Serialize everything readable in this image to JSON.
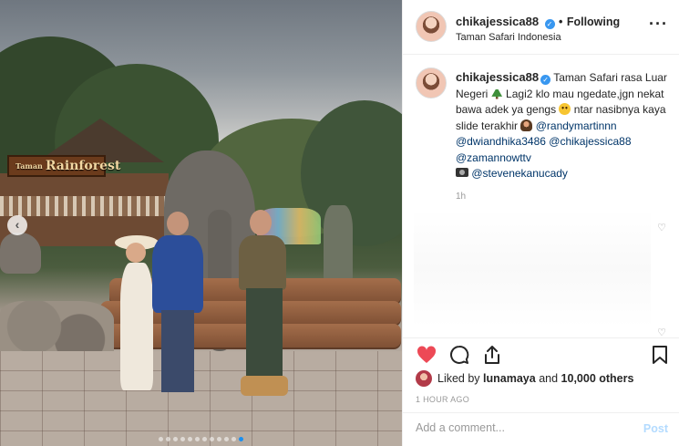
{
  "post": {
    "author": "chikajessica88",
    "follow_status": "Following",
    "separator": "•",
    "location": "Taman Safari Indonesia"
  },
  "photo": {
    "sign_small": "Taman",
    "sign_text": "Rainforest",
    "carousel_dots": 12,
    "active_dot": 11
  },
  "caption": {
    "author": "chikajessica88",
    "text_1": "Taman Safari rasa Luar Negeri",
    "text_2": "Lagi2 klo mau ngedate,jgn nekat bawa adek ya gengs",
    "text_3": "ntar nasibnya kaya slide terakhir",
    "mention_1": "@randymartinnn",
    "mention_2": "@dwiandhika3486",
    "mention_3": "@chikajessica88",
    "mention_4": "@zamannowttv",
    "mention_5": "@stevenekanucady",
    "time": "1h"
  },
  "icons": {
    "more": "more-options-icon",
    "heart": "heart-icon",
    "comment": "comment-icon",
    "share": "share-icon",
    "save": "bookmark-icon"
  },
  "likes": {
    "prefix": "Liked by",
    "user": "lunamaya",
    "joiner": "and",
    "others": "10,000 others"
  },
  "timestamp": "1 HOUR AGO",
  "comment_box": {
    "placeholder": "Add a comment...",
    "post_label": "Post"
  },
  "colors": {
    "liked_heart": "#ed4956",
    "verified": "#3897f0",
    "mention": "#003569",
    "post_disabled": "#b3dbff"
  }
}
